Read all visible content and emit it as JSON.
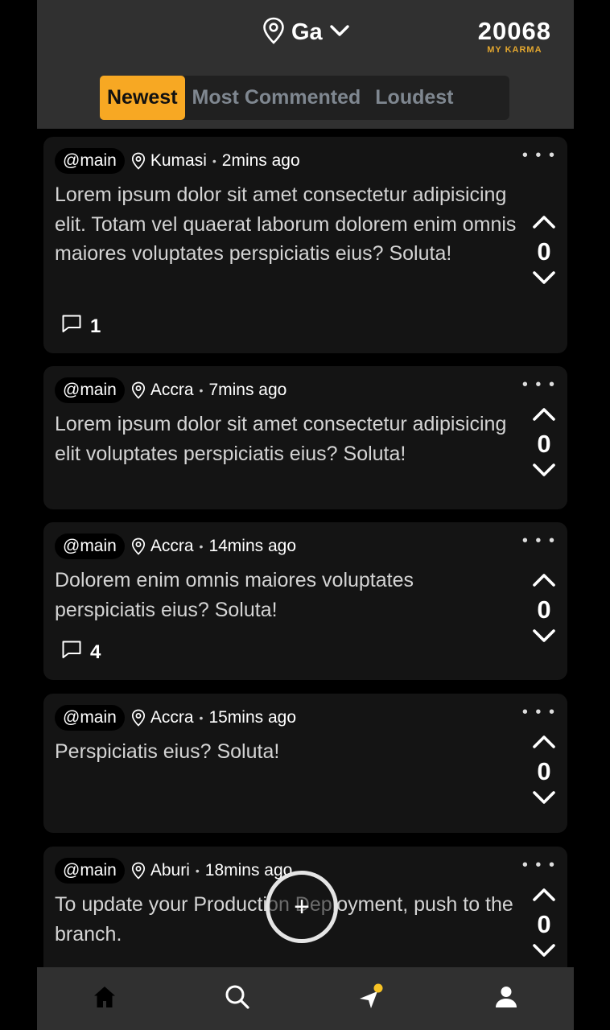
{
  "header": {
    "location_label": "Ga",
    "karma_value": "20068",
    "karma_label": "MY KARMA"
  },
  "tabs": [
    {
      "label": "Newest",
      "active": true
    },
    {
      "label": "Most Commented",
      "active": false
    },
    {
      "label": "Loudest",
      "active": false
    }
  ],
  "posts": [
    {
      "channel": "@main",
      "location": "Kumasi",
      "time": "2mins ago",
      "text": "Lorem ipsum dolor sit amet consectetur adipisicing elit. Totam vel quaerat laborum dolorem enim omnis maiores voluptates perspiciatis eius? Soluta!",
      "comments": "1",
      "score": "0"
    },
    {
      "channel": "@main",
      "location": "Accra",
      "time": "7mins ago",
      "text": "Lorem ipsum dolor sit amet consectetur adipisicing elit voluptates perspiciatis eius? Soluta!",
      "comments": "",
      "score": "0"
    },
    {
      "channel": "@main",
      "location": "Accra",
      "time": "14mins ago",
      "text": "Dolorem enim omnis maiores voluptates perspiciatis eius? Soluta!",
      "comments": "4",
      "score": "0"
    },
    {
      "channel": "@main",
      "location": "Accra",
      "time": "15mins ago",
      "text": "Perspiciatis eius? Soluta!",
      "comments": "",
      "score": "0"
    },
    {
      "channel": "@main",
      "location": "Aburi",
      "time": "18mins ago",
      "text": "To update your Production Deployment, push to the branch.",
      "comments": "",
      "score": "0"
    }
  ],
  "fab": {
    "symbol": "+"
  },
  "colors": {
    "accent": "#f7a823",
    "karma_label": "#e3a72f",
    "notification_dot": "#f7c325"
  },
  "bottom_nav": {
    "icons": [
      "home-icon",
      "search-icon",
      "navigate-icon",
      "profile-icon"
    ]
  }
}
